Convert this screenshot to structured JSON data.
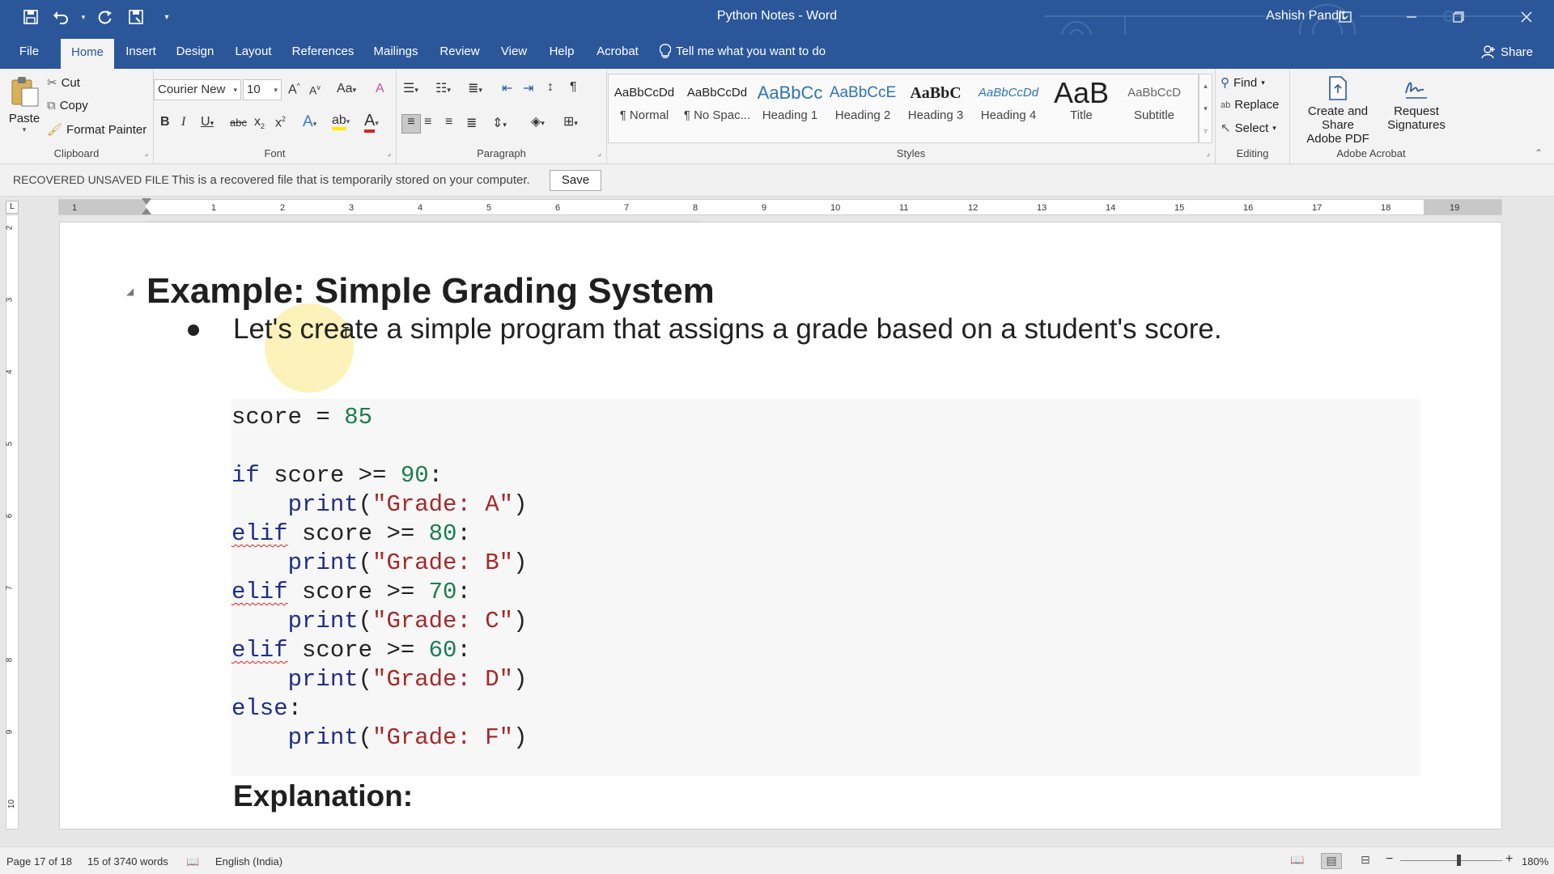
{
  "window": {
    "doc_title": "Python Notes",
    "app_name": "Word",
    "title_separator": " - ",
    "user": "Ashish Pandit",
    "share_label": "Share"
  },
  "tabs": [
    "File",
    "Home",
    "Insert",
    "Design",
    "Layout",
    "References",
    "Mailings",
    "Review",
    "View",
    "Help",
    "Acrobat"
  ],
  "active_tab": "Home",
  "tell_me": "Tell me what you want to do",
  "clipboard": {
    "paste": "Paste",
    "cut": "Cut",
    "copy": "Copy",
    "format_painter": "Format Painter",
    "label": "Clipboard"
  },
  "font": {
    "family": "Courier New",
    "size": "10",
    "label": "Font"
  },
  "paragraph": {
    "label": "Paragraph"
  },
  "styles": {
    "label": "Styles",
    "items": [
      {
        "sample": "AaBbCcDd",
        "name": "¶ Normal"
      },
      {
        "sample": "AaBbCcDd",
        "name": "¶ No Spac..."
      },
      {
        "sample": "AaBbCc",
        "name": "Heading 1"
      },
      {
        "sample": "AaBbCcE",
        "name": "Heading 2"
      },
      {
        "sample": "AaBbC",
        "name": "Heading 3"
      },
      {
        "sample": "AaBbCcDd",
        "name": "Heading 4"
      },
      {
        "sample": "AaB",
        "name": "Title"
      },
      {
        "sample": "AaBbCcD",
        "name": "Subtitle"
      }
    ]
  },
  "editing": {
    "find": "Find",
    "replace": "Replace",
    "select": "Select",
    "label": "Editing"
  },
  "acrobat": {
    "create_share_line1": "Create and Share",
    "create_share_line2": "Adobe PDF",
    "request_line1": "Request",
    "request_line2": "Signatures",
    "label": "Adobe Acrobat"
  },
  "infobar": {
    "title": "RECOVERED UNSAVED FILE",
    "message": "This is a recovered file that is temporarily stored on your computer.",
    "save": "Save"
  },
  "document": {
    "heading": "Example: Simple Grading System",
    "bullet": "Let's create a simple program that assigns a grade based on a student's score.",
    "code": [
      [
        [
          "",
          "score = "
        ],
        [
          "num",
          "85"
        ]
      ],
      [],
      [
        [
          "kw",
          "if"
        ],
        [
          "",
          " score >= "
        ],
        [
          "num",
          "90"
        ],
        [
          "",
          ":"
        ]
      ],
      [
        [
          "",
          "    "
        ],
        [
          "fn",
          "print"
        ],
        [
          "",
          "("
        ],
        [
          "str",
          "\"Grade: A\""
        ],
        [
          "",
          ")"
        ]
      ],
      [
        [
          "kw squig",
          "elif"
        ],
        [
          "",
          " score >= "
        ],
        [
          "num",
          "80"
        ],
        [
          "",
          ":"
        ]
      ],
      [
        [
          "",
          "    "
        ],
        [
          "fn",
          "print"
        ],
        [
          "",
          "("
        ],
        [
          "str",
          "\"Grade: B\""
        ],
        [
          "",
          ")"
        ]
      ],
      [
        [
          "kw squig",
          "elif"
        ],
        [
          "",
          " score >= "
        ],
        [
          "num",
          "70"
        ],
        [
          "",
          ":"
        ]
      ],
      [
        [
          "",
          "    "
        ],
        [
          "fn",
          "print"
        ],
        [
          "",
          "("
        ],
        [
          "str",
          "\"Grade: C\""
        ],
        [
          "",
          ")"
        ]
      ],
      [
        [
          "kw squig",
          "elif"
        ],
        [
          "",
          " score >= "
        ],
        [
          "num",
          "60"
        ],
        [
          "",
          ":"
        ]
      ],
      [
        [
          "",
          "    "
        ],
        [
          "fn",
          "print"
        ],
        [
          "",
          "("
        ],
        [
          "str",
          "\"Grade: D\""
        ],
        [
          "",
          ")"
        ]
      ],
      [
        [
          "kw",
          "else"
        ],
        [
          "",
          ":"
        ]
      ],
      [
        [
          "",
          "    "
        ],
        [
          "fn",
          "print"
        ],
        [
          "",
          "("
        ],
        [
          "str",
          "\"Grade: F\""
        ],
        [
          "",
          ")"
        ]
      ]
    ],
    "explanation": "Explanation:"
  },
  "status": {
    "page": "Page 17 of 18",
    "words": "15 of 3740 words",
    "language": "English (India)",
    "zoom": "180%"
  },
  "ruler": {
    "h_ticks": [
      "1",
      "1",
      "2",
      "3",
      "4",
      "5",
      "6",
      "7",
      "8",
      "9",
      "10",
      "11",
      "12",
      "13",
      "14",
      "15",
      "16",
      "17",
      "18",
      "19"
    ],
    "v_ticks": [
      "2",
      "3",
      "4",
      "5",
      "6",
      "7",
      "8",
      "9",
      "10"
    ]
  },
  "colors": {
    "brand": "#2b579a",
    "keyword": "#1f2e8c",
    "number": "#1b7c50",
    "string": "#a52a2a"
  }
}
